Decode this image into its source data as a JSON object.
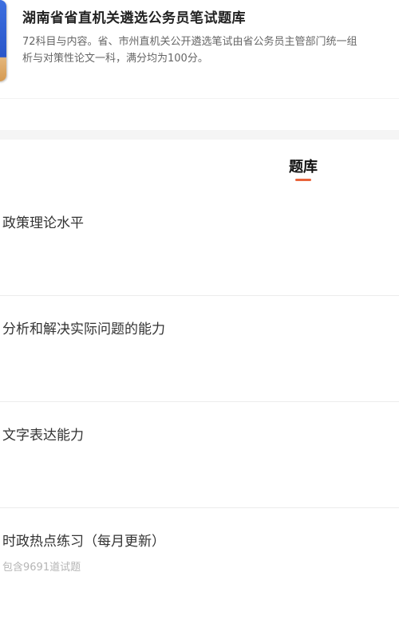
{
  "header": {
    "title": "湖南省省直机关遴选公务员笔试题库",
    "description_lines": [
      "72科目与内容。省、市州直机关公开遴选笔试由省公务员主管部门统一组",
      "析与对策性论文一科，满分均为100分。"
    ]
  },
  "tabs": {
    "active_label": "题库",
    "accent_color": "#e8643c"
  },
  "subjects": [
    {
      "name": "政策理论水平",
      "count_text": ""
    },
    {
      "name": "分析和解决实际问题的能力",
      "count_text": ""
    },
    {
      "name": "文字表达能力",
      "count_text": ""
    },
    {
      "name": "时政热点练习（每月更新）",
      "count_text": "包含9691道试题"
    }
  ]
}
